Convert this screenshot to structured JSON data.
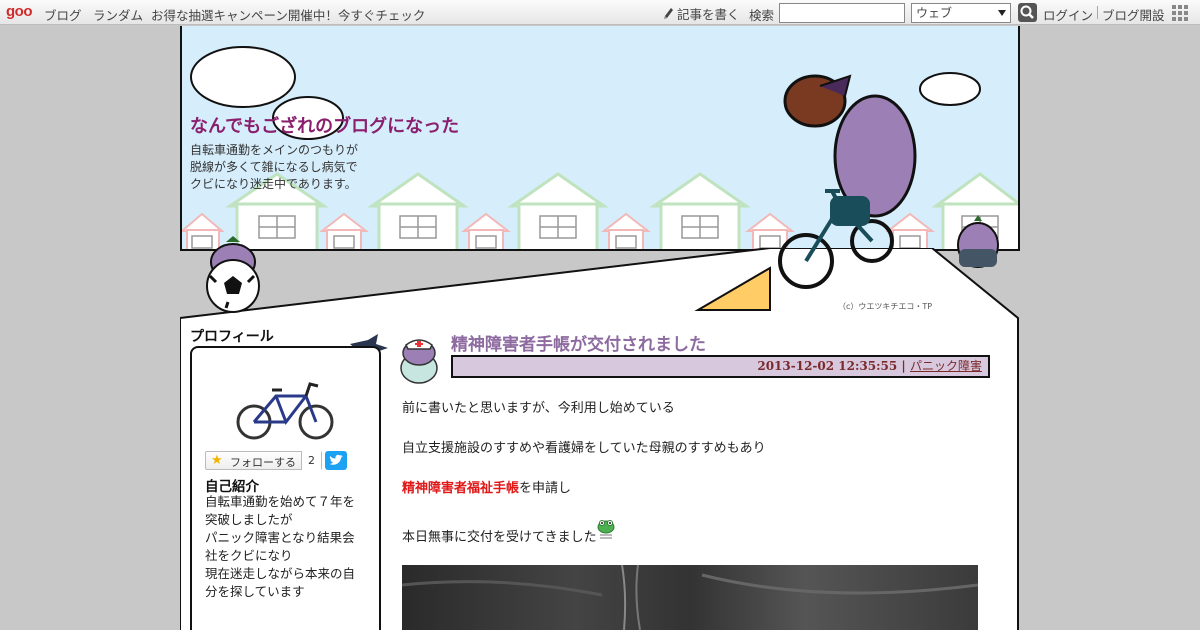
{
  "topbar": {
    "logo": "goo",
    "nav": [
      "ブログ",
      "ランダム",
      "お得な抽選キャンペーン開催中！今すぐチェック"
    ],
    "write_label": "記事を書く",
    "search_label": "検索",
    "search_value": "",
    "search_select": "ウェブ",
    "login": "ログイン",
    "open_blog": "ブログ開設"
  },
  "header": {
    "title": "なんでもござれのブログになった",
    "description": [
      "自転車通勤をメインのつもりが",
      "脱線が多くて雑になるし病気で",
      "クビになり迷走中であります。"
    ],
    "copyright": "（c）ウエツキチエコ・TP"
  },
  "profile": {
    "heading": "プロフィール",
    "follow_label": "フォローする",
    "follow_count": "2",
    "intro_heading": "自己紹介",
    "intro_lines": [
      "自転車通勤を始めて７年を",
      "突破しましたが",
      "パニック障害となり結果会",
      "社をクビになり",
      "現在迷走しながら本来の自",
      "分を探しています"
    ]
  },
  "article": {
    "title": "精神障害者手帳が交付されました",
    "date": "2013-12-02 12:35:55",
    "separator": " | ",
    "category": "パニック障害",
    "line1": "前に書いたと思いますが、今利用し始めている",
    "line2": "自立支援施設のすすめや看護婦をしていた母親のすすめもあり",
    "line3_red": "精神障害者福祉手帳",
    "line3_rest": "を申請し",
    "line4": "本日無事に交付を受けてきました"
  },
  "colors": {
    "title": "#8a1f6e",
    "article_title": "#8d6a9f",
    "meta_bg": "#d8c8dd",
    "header_bg": "#d6eefb",
    "highlight": "#e01818"
  }
}
